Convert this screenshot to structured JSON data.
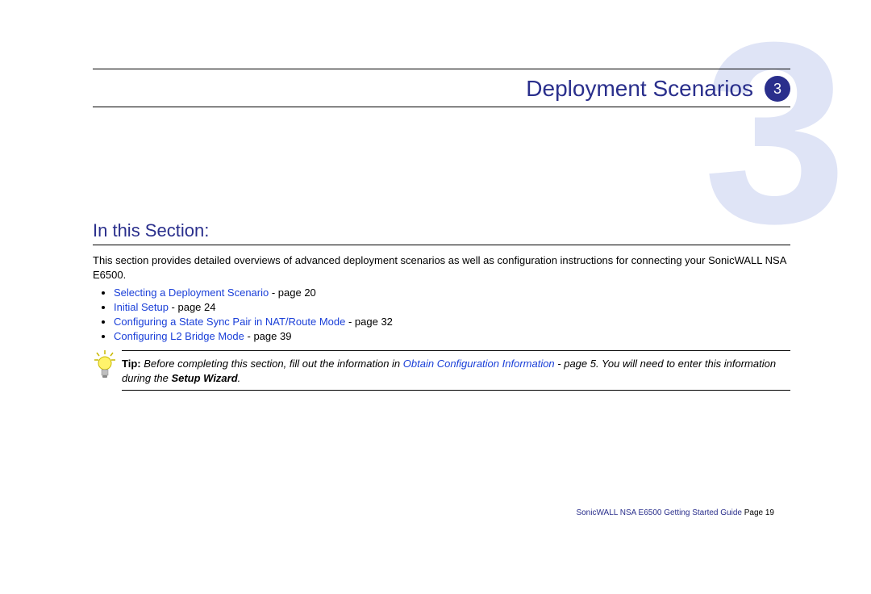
{
  "chapter": {
    "bg_number": "3",
    "title": "Deployment Scenarios",
    "badge": "3"
  },
  "section": {
    "header": "In this Section:",
    "intro": "This section provides detailed overviews of advanced deployment scenarios as well as configuration instructions for connecting your SonicWALL NSA E6500.",
    "links": [
      {
        "label": "Selecting a Deployment Scenario",
        "page": " - page 20"
      },
      {
        "label": "Initial Setup",
        "page": " - page 24"
      },
      {
        "label": "Configuring a State Sync Pair in NAT/Route Mode",
        "page": " - page 32"
      },
      {
        "label": "Configuring L2 Bridge Mode",
        "page": " - page 39"
      }
    ]
  },
  "tip": {
    "label": "Tip:",
    "before": "Before completing this section, fill out the information in ",
    "link": "Obtain Configuration Information",
    "mid": " - page 5. You will need to enter this information during the ",
    "wizard": "Setup Wizard",
    "after": "."
  },
  "footer": {
    "guide": "SonicWALL NSA E6500 Getting Started Guide",
    "page": "  Page 19"
  }
}
